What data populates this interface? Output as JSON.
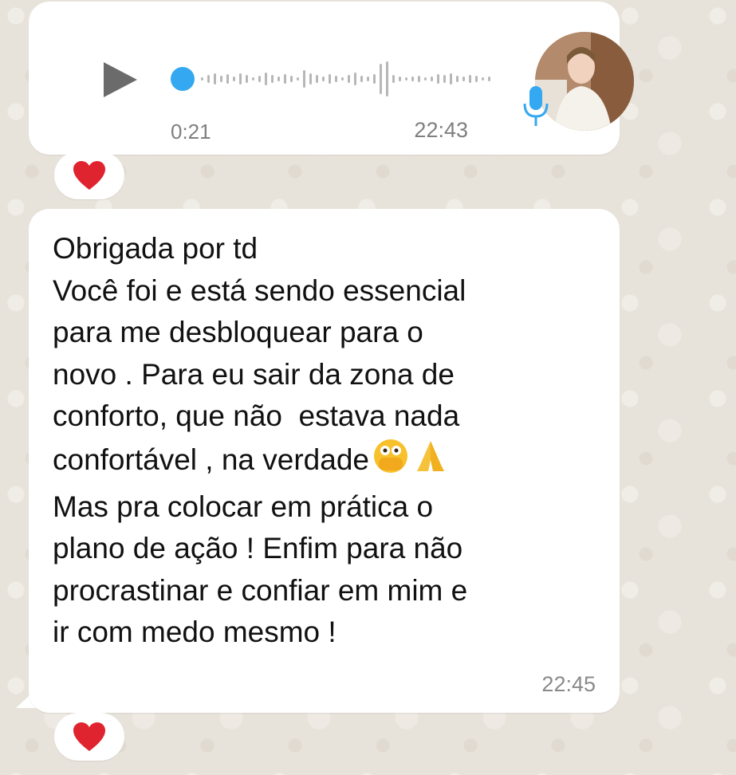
{
  "voice_message": {
    "duration": "0:21",
    "time": "22:43",
    "icons": [
      "play-icon",
      "microphone-icon"
    ],
    "progress": 0.0
  },
  "text_message": {
    "lines": [
      "Obrigada por td",
      "Você foi e está sendo essencial",
      "para me desbloquear para o",
      "novo . Para eu sair da zona de",
      "conforto, que não  estava nada",
      "confortável , na verdade",
      "Mas pra colocar em prática o",
      "plano de ação ! Enfim para não",
      "procrastinar e confiar em mim e",
      "ir com medo mesmo !"
    ],
    "inline_emojis": [
      "face-with-open-eyes-and-hand-over-mouth-emoji",
      "folded-hands-emoji"
    ],
    "time": "22:45"
  },
  "reactions": [
    "heart",
    "heart"
  ],
  "colors": {
    "bubble": "#ffffff",
    "wallpaper": "#e8e3da",
    "accent": "#34a8f0",
    "heart": "#e0242f"
  }
}
